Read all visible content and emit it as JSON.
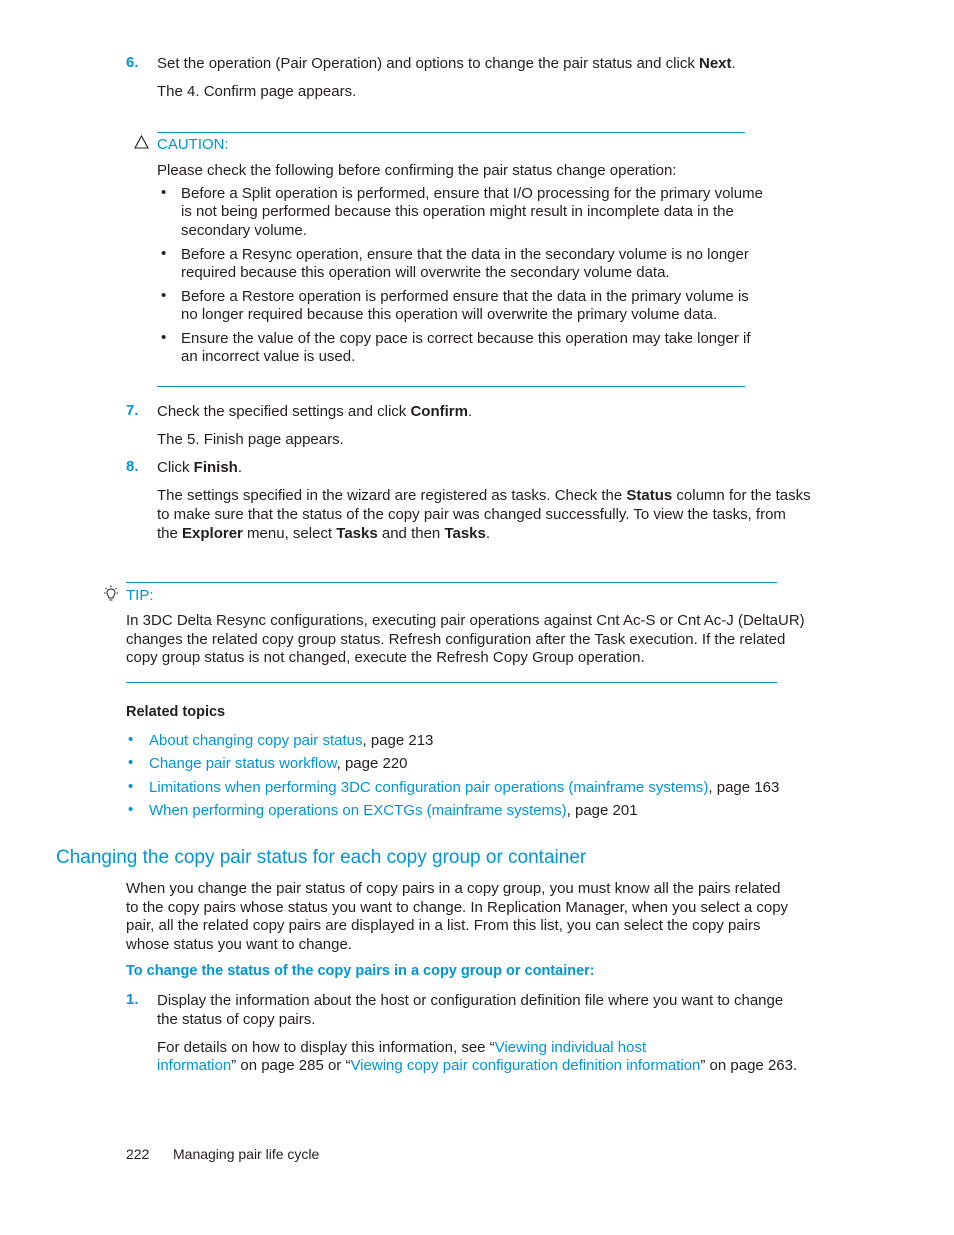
{
  "step6": {
    "number": "6.",
    "text_before": "Set the operation (Pair Operation) and options to change the pair status and click ",
    "bold": "Next",
    "text_after": ".",
    "result": "The 4. Confirm page appears."
  },
  "caution": {
    "icon": "warning-triangle-icon",
    "label": "CAUTION:",
    "intro": "Please check the following before confirming the pair status change operation:",
    "items": [
      [
        "Before a Split operation is performed, ensure that I/O processing for the primary volume",
        "is not being performed because this operation might result in incomplete data in the",
        "secondary volume."
      ],
      [
        "Before a Resync operation, ensure that the data in the secondary volume is no longer",
        "required because this operation will overwrite the secondary volume data."
      ],
      [
        "Before a Restore operation is performed ensure that the data in the primary volume is",
        "no longer required because this operation will overwrite the primary volume data."
      ],
      [
        "Ensure the value of the copy pace is correct because this operation may take longer if",
        "an incorrect value is used."
      ]
    ]
  },
  "step7": {
    "number": "7.",
    "text_before": "Check the specified settings and click ",
    "bold": "Confirm",
    "text_after": ".",
    "result": "The 5. Finish page appears."
  },
  "step8": {
    "number": "8.",
    "text_before": "Click ",
    "bold": "Finish",
    "text_after": ".",
    "para": {
      "l1a": "The settings specified in the wizard are registered as tasks. Check the ",
      "l1b": "Status",
      "l1c": " column for the tasks",
      "l2": "to make sure that the status of the copy pair was changed successfully. To view the tasks, from",
      "l3a": "the ",
      "l3b": "Explorer",
      "l3c": " menu, select ",
      "l3d": "Tasks",
      "l3e": " and then ",
      "l3f": "Tasks",
      "l3g": "."
    }
  },
  "tip": {
    "icon": "lightbulb-icon",
    "label": "TIP:",
    "lines": [
      "In 3DC Delta Resync configurations, executing pair operations against Cnt Ac-S or Cnt Ac-J (DeltaUR)",
      "changes the related copy group status. Refresh configuration after the Task execution. If the related",
      "copy group status is not changed, execute the Refresh Copy Group operation."
    ]
  },
  "related": {
    "heading": "Related topics",
    "items": [
      {
        "link": "About changing copy pair status",
        "suffix": ", page 213"
      },
      {
        "link": "Change pair status workflow",
        "suffix": ", page 220"
      },
      {
        "link": "Limitations when performing 3DC configuration pair operations (mainframe systems)",
        "suffix": ", page 163"
      },
      {
        "link": "When performing operations on EXCTGs (mainframe systems)",
        "suffix": ", page 201"
      }
    ]
  },
  "section": {
    "title": "Changing the copy pair status for each copy group or container",
    "para": [
      "When you change the pair status of copy pairs in a copy group, you must know all the pairs related",
      "to the copy pairs whose status you want to change. In Replication Manager, when you select a copy",
      "pair, all the related copy pairs are displayed in a list. From this list, you can select the copy pairs",
      "whose status you want to change."
    ],
    "procedure_title": "To change the status of the copy pairs in a copy group or container:",
    "step1": {
      "number": "1.",
      "lines": [
        "Display the information about the host or configuration definition file where you want to change",
        "the status of copy pairs."
      ],
      "details_a": "For details on how to display this information, see “",
      "link1_a": "Viewing individual host",
      "link1_b": "information",
      "details_b": "” on page 285 or “",
      "link2": "Viewing copy pair configuration definition information",
      "details_c": "” on page 263."
    }
  },
  "footer": {
    "page_number": "222",
    "chapter": "Managing pair life cycle"
  }
}
